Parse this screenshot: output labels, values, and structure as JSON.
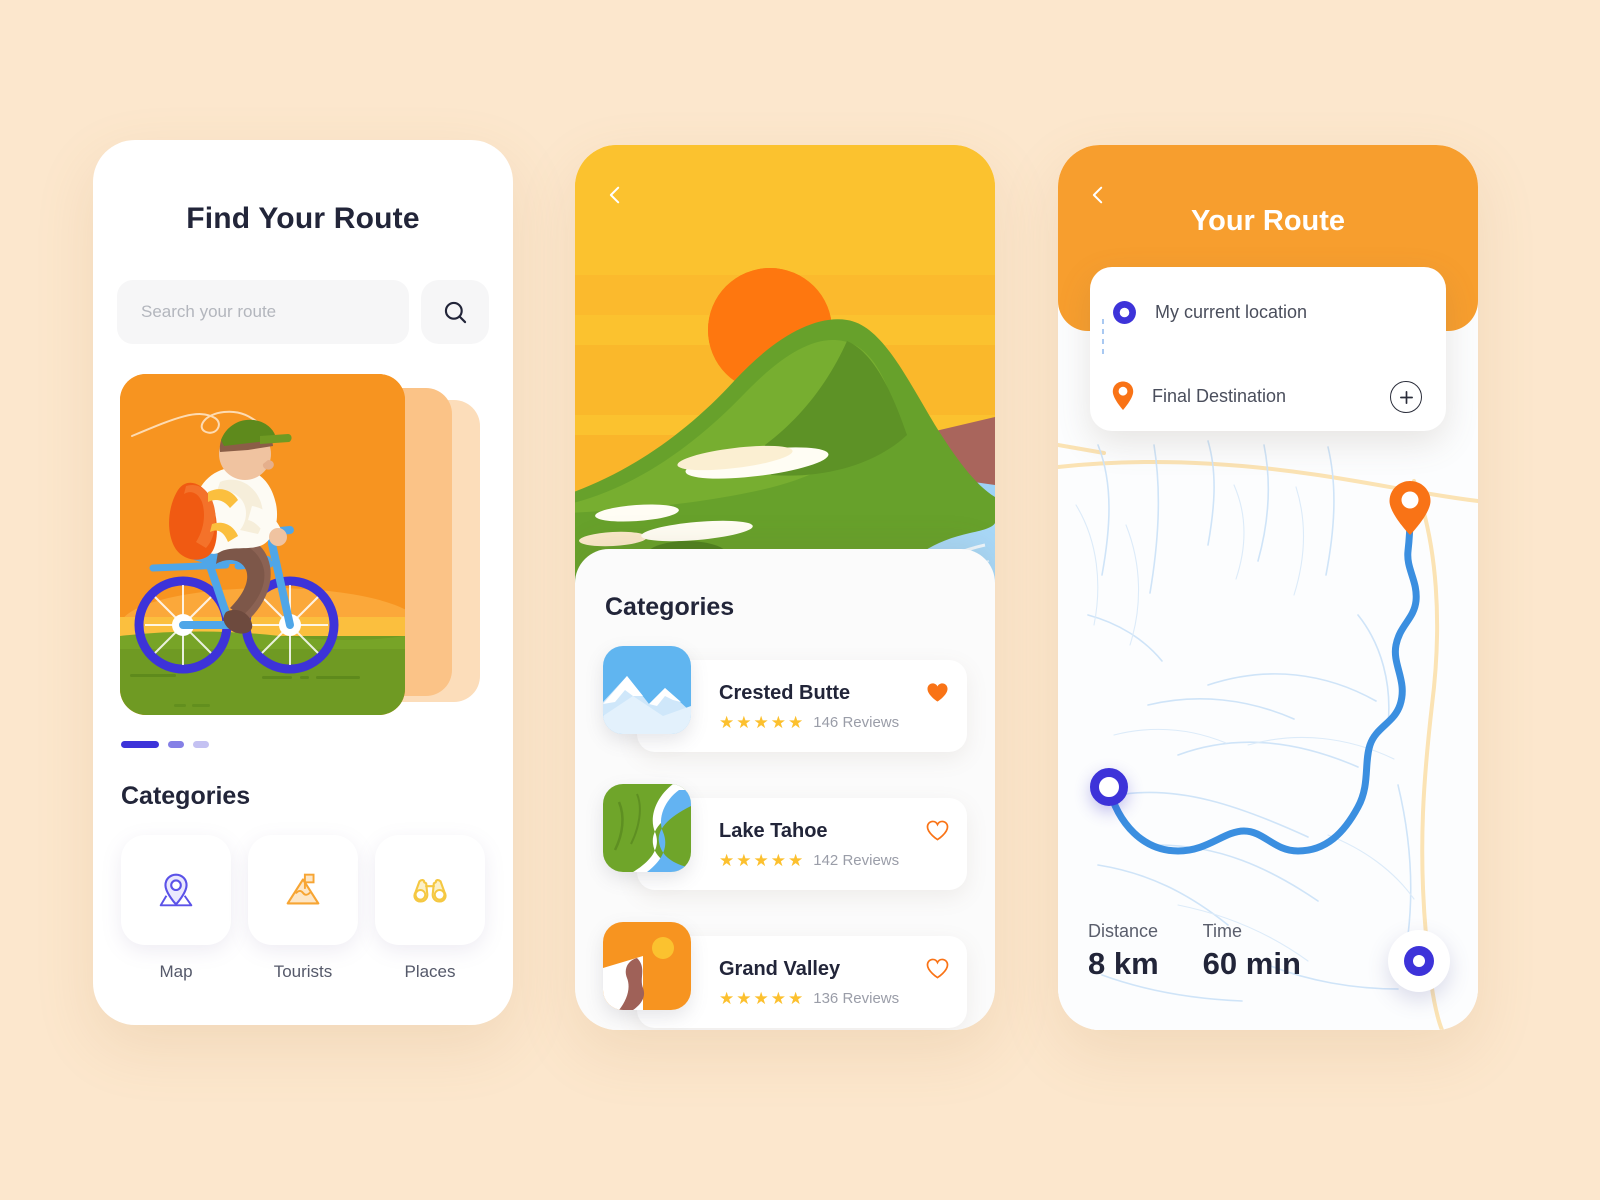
{
  "theme": {
    "background": "#FCE7CD",
    "accent_orange": "#F79420",
    "header_orange": "#F79E2E",
    "accent_indigo": "#3D33D9",
    "star_gold": "#FCC02E",
    "heart_orange": "#F97316",
    "route_blue": "#3B8FE0"
  },
  "screen1": {
    "title": "Find Your Route",
    "search": {
      "placeholder": "Search your route",
      "value": "",
      "icon": "search-icon"
    },
    "carousel": {
      "active_index": 0,
      "slide_count": 3,
      "illustration": "cyclist-with-backpack-at-sunset"
    },
    "categories_title": "Categories",
    "categories": [
      {
        "label": "Map",
        "icon": "map-pin-icon",
        "color": "#5B52E8"
      },
      {
        "label": "Tourists",
        "icon": "mountain-flag-icon",
        "color": "#F7A533"
      },
      {
        "label": "Places",
        "icon": "binoculars-icon",
        "color": "#F5C842"
      }
    ]
  },
  "screen2": {
    "back_icon": "chevron-left-icon",
    "hero_illustration": "sunset-mountain-river-landscape",
    "sheet_title": "Categories",
    "places": [
      {
        "name": "Crested Butte",
        "rating": 5,
        "reviews": "146 Reviews",
        "favorite": true,
        "thumb": "snow-mountains-thumb"
      },
      {
        "name": "Lake Tahoe",
        "rating": 5,
        "reviews": "142 Reviews",
        "favorite": false,
        "thumb": "green-river-thumb"
      },
      {
        "name": "Grand Valley",
        "rating": 5,
        "reviews": "136 Reviews",
        "favorite": false,
        "thumb": "orange-canyon-thumb"
      }
    ]
  },
  "screen3": {
    "back_icon": "chevron-left-icon",
    "title": "Your Route",
    "route": {
      "origin_label": "My current location",
      "origin_icon": "current-location-dot-icon",
      "destination_label": "Final Destination",
      "destination_icon": "map-pin-icon",
      "add_stop_icon": "plus-circle-icon"
    },
    "stats": [
      {
        "key": "Distance",
        "value": "8 km"
      },
      {
        "key": "Time",
        "value": "60 min"
      }
    ],
    "locate_button_icon": "locate-me-icon"
  }
}
